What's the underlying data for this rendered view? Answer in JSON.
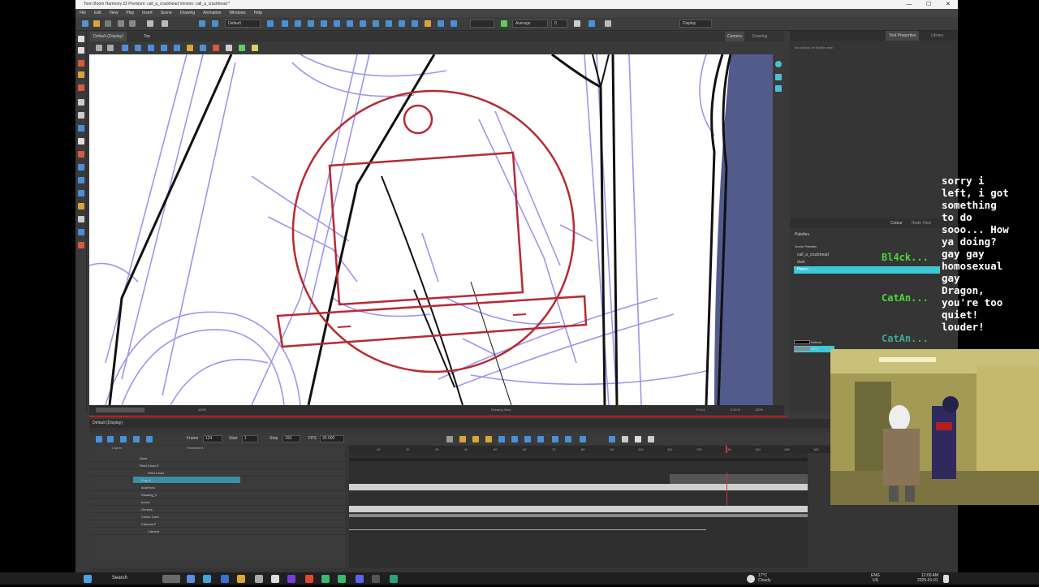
{
  "window": {
    "title": "Toon Boom Harmony 22 Premium: call_a_crackhead Version: call_a_crackhead *",
    "controls": [
      "—",
      "☐",
      "✕"
    ]
  },
  "menu": [
    "File",
    "Edit",
    "View",
    "Play",
    "Insert",
    "Scene",
    "Drawing",
    "Animation",
    "Windows",
    "Help"
  ],
  "toolbar": {
    "preset_dropdown": "Default",
    "average_dropdown": "Average",
    "average_value": "0",
    "display_dropdown": "Display"
  },
  "view": {
    "tab_label": "Default (Display)",
    "top_label": "Top",
    "right_tabs": [
      "Camera",
      "Drawing"
    ],
    "status_left": "100%",
    "status_mid": "Drawing View",
    "status_frame": "Fr124",
    "status_coord": "0.00 N",
    "status_zoom": "100%"
  },
  "right_panel": {
    "tabs": [
      "Tool Properties",
      "Library"
    ],
    "tool_text": "No options for Rotate view",
    "palette_tabs": [
      "Colour",
      "Node View"
    ],
    "palette_header": "Palettes",
    "scene_palettes_label": "Scene Palettes",
    "palettes": [
      {
        "name": "call_a_crackhead",
        "selected": false
      },
      {
        "name": "dust",
        "selected": false
      },
      {
        "name": "Hoero",
        "selected": true
      }
    ],
    "colors": [
      "Default",
      "New"
    ]
  },
  "timeline": {
    "header": "Default (Display)",
    "frame_label": "Frame",
    "frame_value": "124",
    "start_label": "Start",
    "start_value": "1",
    "stop_label": "Stop",
    "stop_value": "150",
    "fps_label": "FPS",
    "fps_value": "30.000",
    "layers_header": "Layers",
    "params_header": "Parameters",
    "ruler_ticks": [
      "10",
      "20",
      "30",
      "40",
      "50",
      "60",
      "70",
      "80",
      "90",
      "100",
      "110",
      "120",
      "130",
      "140",
      "150",
      "160",
      "170",
      "180"
    ],
    "layers": [
      {
        "name": "Drive",
        "selected": false,
        "indent": 0
      },
      {
        "name": "Field-Chart-P",
        "selected": false,
        "indent": 1
      },
      {
        "name": "Field-Chart",
        "selected": false,
        "indent": 2
      },
      {
        "name": "Peg-ol",
        "selected": true,
        "indent": 1
      },
      {
        "name": "dustFeed",
        "selected": false,
        "indent": 1
      },
      {
        "name": "Drawing_1",
        "selected": false,
        "indent": 1
      },
      {
        "name": "horror",
        "selected": false,
        "indent": 1
      },
      {
        "name": "Onness",
        "selected": false,
        "indent": 1
      },
      {
        "name": "Colour Card",
        "selected": false,
        "indent": 1
      },
      {
        "name": "Camera-P",
        "selected": false,
        "indent": 1
      },
      {
        "name": "Camera",
        "selected": false,
        "indent": 2
      }
    ]
  },
  "chat": {
    "messages": [
      "sorry i",
      "left, i got",
      "something",
      "to do",
      "sooo... How",
      "ya doing?",
      "gay gay",
      "homosexual",
      "gay",
      "Dragon,",
      "you're too",
      "quiet!",
      "louder!"
    ],
    "names": [
      "Bl4ck...",
      "CatAn...",
      "CatAn..."
    ]
  },
  "taskbar": {
    "search": "Search",
    "weather_temp": "17°C",
    "weather_text": "Cloudy",
    "lang": "ENG",
    "region": "US",
    "time": "12:00 AM",
    "date": "2025-01-01"
  },
  "colors": {
    "accent": "#3ec9d8",
    "red_guide": "#b82a32",
    "sketch_blue": "#7b74e8"
  }
}
